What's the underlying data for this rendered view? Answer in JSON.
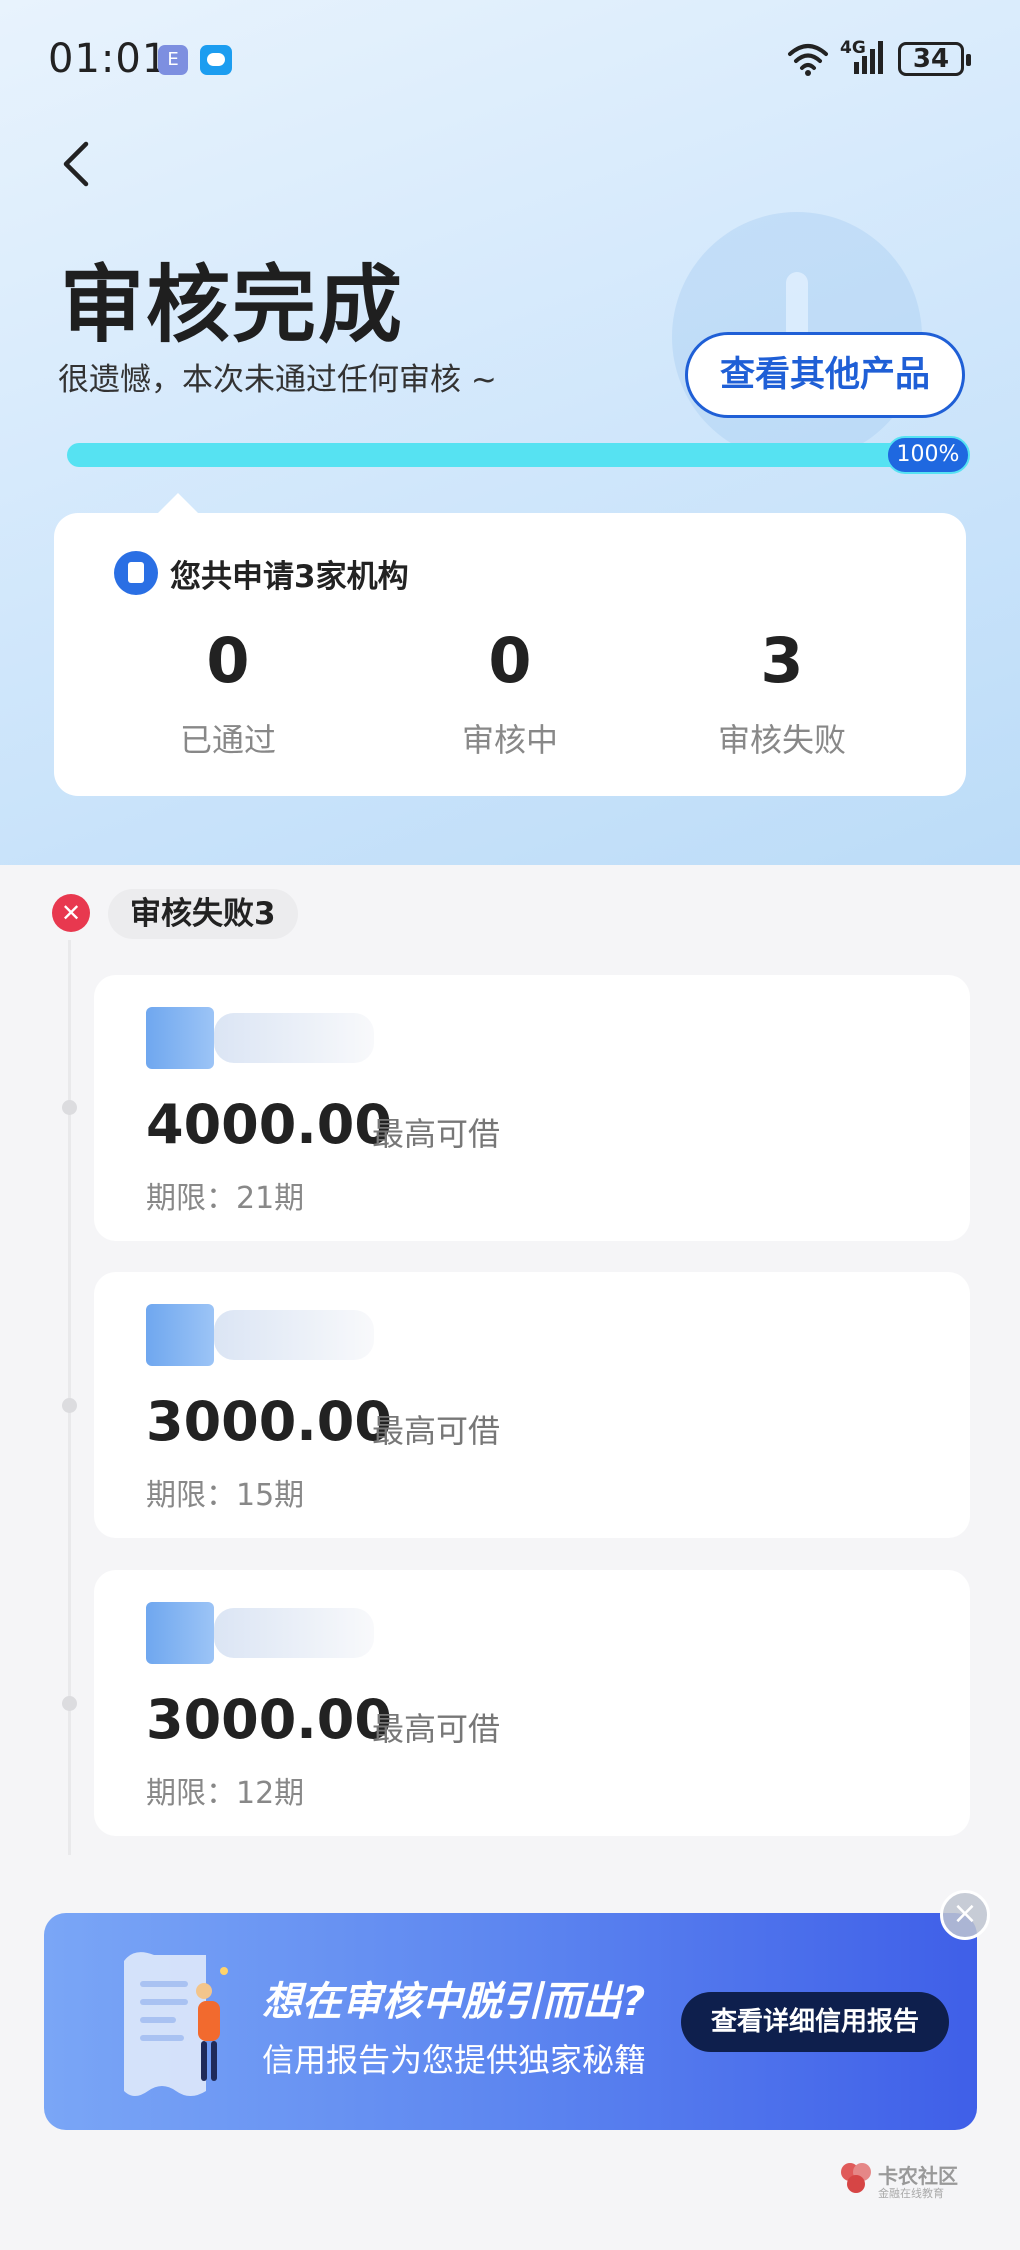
{
  "status_bar": {
    "time": "01:01",
    "network": "4G",
    "battery": "34"
  },
  "header": {
    "title": "审核完成",
    "subtitle": "很遗憾，本次未通过任何审核 ~",
    "other_products_label": "查看其他产品",
    "progress_percent": 100,
    "progress_label": "100%"
  },
  "summary": {
    "title": "您共申请3家机构",
    "stats": [
      {
        "value": "0",
        "label": "已通过"
      },
      {
        "value": "0",
        "label": "审核中"
      },
      {
        "value": "3",
        "label": "审核失败"
      }
    ]
  },
  "failed_section": {
    "tag": "审核失败3",
    "loans": [
      {
        "amount": "4000.00",
        "max_label": "最高可借",
        "term": "期限：21期"
      },
      {
        "amount": "3000.00",
        "max_label": "最高可借",
        "term": "期限：15期"
      },
      {
        "amount": "3000.00",
        "max_label": "最高可借",
        "term": "期限：12期"
      }
    ]
  },
  "banner": {
    "headline": "想在审核中脱引而出?",
    "sub": "信用报告为您提供独家秘籍",
    "button": "查看详细信用报告"
  },
  "watermark": {
    "name": "卡农社区",
    "sub": "金融在线教育"
  },
  "colors": {
    "accent": "#1f5fd6",
    "progress": "#56e2f2",
    "fail": "#e8384f"
  }
}
